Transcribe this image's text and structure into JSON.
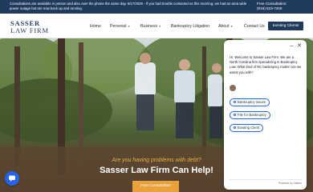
{
  "topbar": {
    "message": "Consultations are available in person and also over the phone the same day. 6/17/2026 - If you had trouble contacted us this morning, we had an area wide power outage but are now back up and running.",
    "consultation_label": "Free Consultation:",
    "phone": "(919) 519-7400"
  },
  "brand": {
    "line1": "SASSER",
    "line2": "LAW FIRM"
  },
  "nav": {
    "items": [
      {
        "label": "Home"
      },
      {
        "label": "Personal"
      },
      {
        "label": "Business"
      },
      {
        "label": "Bankruptcy Litigation"
      },
      {
        "label": "About"
      },
      {
        "label": "Contact Us"
      }
    ],
    "cta": "Existing Clients"
  },
  "hero": {
    "subheadline": "Are you having problems with debt?",
    "headline": "Sasser Law Firm Can Help!",
    "button": "Free Consultation"
  },
  "chat": {
    "greeting": "Hi. Welcome to Sasser Law Firm. We are a North Carolina firm specializing in Bankruptcy Law. What kind of NC bankruptcy matter can we assist you with?",
    "options": [
      {
        "label": "Bankruptcy Issues"
      },
      {
        "label": "File for Bankruptcy"
      },
      {
        "label": "Existing Client"
      }
    ],
    "powered_by": "Powered by Intaker"
  },
  "icons": {
    "chevron": "chevron-down-icon",
    "close": "close-icon",
    "minimize": "minimize-icon",
    "chat": "chat-bubble-icon"
  },
  "colors": {
    "navy": "#1f3a5c",
    "accent_gold": "#e9b53e",
    "cta_orange": "#e9a23b",
    "chat_blue": "#2563eb"
  }
}
